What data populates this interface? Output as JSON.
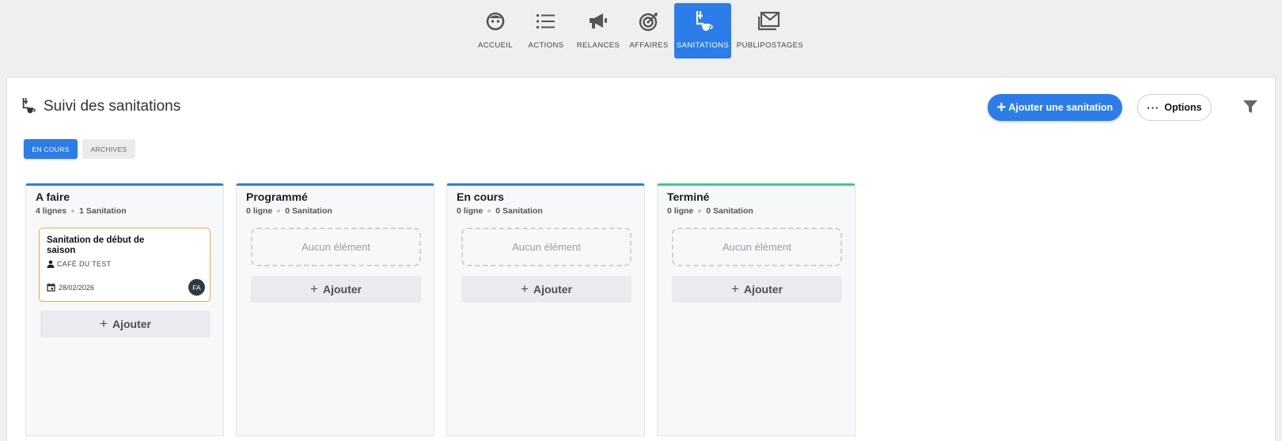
{
  "nav": {
    "items": [
      {
        "label": "ACCUEIL",
        "icon": "face-icon"
      },
      {
        "label": "ACTIONS",
        "icon": "list-icon"
      },
      {
        "label": "RELANCES",
        "icon": "megaphone-icon"
      },
      {
        "label": "AFFAIRES",
        "icon": "target-icon"
      },
      {
        "label": "SANITATIONS",
        "icon": "tap-cup-icon",
        "active": true
      },
      {
        "label": "PUBLIPOSTAGES",
        "icon": "mail-icon"
      }
    ]
  },
  "header": {
    "title": "Suivi des sanitations",
    "add_label": "Ajouter une sanitation",
    "options_label": "Options"
  },
  "tabs": [
    {
      "label": "EN COURS",
      "active": true
    },
    {
      "label": "ARCHIVES",
      "active": false
    }
  ],
  "board": {
    "columns": [
      {
        "title": "A faire",
        "lines": "4 lignes",
        "count": "1 Sanitation",
        "accent": "#2b7de9",
        "cards": [
          {
            "title": "Sanitation de début de saison",
            "client": "CAFÉ DU TEST",
            "date": "28/02/2026",
            "avatar": "FA"
          }
        ],
        "add_label": "Ajouter"
      },
      {
        "title": "Programmé",
        "lines": "0 ligne",
        "count": "0 Sanitation",
        "accent": "#2b7de9",
        "empty_label": "Aucun élément",
        "add_label": "Ajouter"
      },
      {
        "title": "En cours",
        "lines": "0 ligne",
        "count": "0 Sanitation",
        "accent": "#2b7de9",
        "empty_label": "Aucun élément",
        "add_label": "Ajouter"
      },
      {
        "title": "Terminé",
        "lines": "0 ligne",
        "count": "0 Sanitation",
        "accent": "#3ec98e",
        "empty_label": "Aucun élément",
        "add_label": "Ajouter"
      }
    ]
  },
  "colors": {
    "primary": "#2b7de9",
    "done": "#3ec98e",
    "card_border": "#f2a93b"
  }
}
